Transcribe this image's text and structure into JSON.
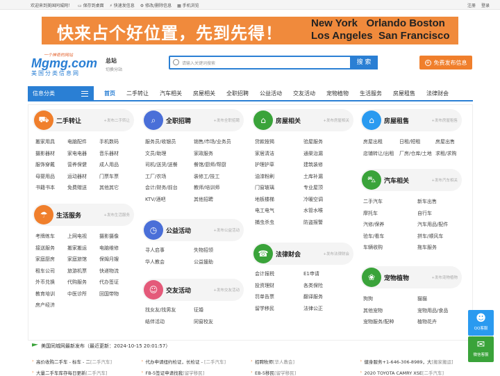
{
  "topbar": {
    "welcome": "欢迎来到美国同城网！",
    "save_desktop": "保存到桌面",
    "quick_post": "快速发信息",
    "edit_delete": "修改/删除信息",
    "mobile": "手机浏览",
    "register": "注册",
    "login": "登录"
  },
  "banner": {
    "slogan": "快来占个好位置，先到先得！",
    "city1a": "New York",
    "city1b": "Orlando",
    "city1c": "Boston",
    "city2a": "Los Angeles",
    "city2b": "San Francisco"
  },
  "logo": {
    "slogan": "一个神奇的网站",
    "main": "Mgmg.com",
    "sub": "美国分类信息网"
  },
  "region": {
    "name": "总站",
    "switch": "切换分站"
  },
  "search": {
    "placeholder": "请输入关键词搜索",
    "button": "搜 索"
  },
  "post_button": "免费发布信息",
  "nav": {
    "category": "信息分类",
    "items": [
      "首页",
      "二手转让",
      "汽车相关",
      "房屋相关",
      "全职招聘",
      "公益活动",
      "交友活动",
      "宠物植物",
      "生活服务",
      "房屋租售",
      "法律财会"
    ]
  },
  "colors": {
    "brand": "#2a7fd4",
    "accent": "#f07f2c",
    "green": "#3aa33a"
  },
  "blocks": {
    "secondhand": {
      "title": "二手转让",
      "more": "+发布二手转让",
      "links": [
        "搬家用具",
        "电脑配件",
        "手机数码",
        "摄影器材",
        "家电电器",
        "音乐器材",
        "服饰穿戴",
        "营养保健",
        "成人用品",
        "母婴用品",
        "运动器材",
        "门票车票",
        "书籍书本",
        "免费赠送",
        "其他其它"
      ]
    },
    "life": {
      "title": "生活服务",
      "more": "+发布生活服务",
      "links": [
        "考牌练车",
        "上网电视",
        "摄影摄像",
        "接送服务",
        "搬家搬运",
        "电脑维修",
        "家庭厨房",
        "家庭旅馆",
        "保姆月嫂",
        "租车公司",
        "旅游机票",
        "快递物流",
        "外币兑换",
        "代购服务",
        "代办签证",
        "教育培训",
        "中医诊所",
        "回国带物",
        "房产经济"
      ]
    },
    "jobs": {
      "title": "全职招聘",
      "more": "+发布全职招聘",
      "links": [
        "服务员/收银员",
        "销售/市场/业务员",
        "文员/助理",
        "家政服务",
        "司机/送货/送餐",
        "餐馆/厨师/帮厨",
        "工厂/农场",
        "装修工/技工",
        "会计/财务/前台",
        "教师/培训师",
        "KTV/酒吧",
        "其他招聘"
      ]
    },
    "charity": {
      "title": "公益活动",
      "more": "+发布公益活动",
      "links": [
        "寻人启事",
        "失物招领",
        "华人教会",
        "公益援助"
      ]
    },
    "dating": {
      "title": "交友活动",
      "more": "+发布交友活动",
      "links": [
        "找女友/找男友",
        "征婚",
        "结伴活动",
        "同窗校友"
      ]
    },
    "housing": {
      "title": "房屋相关",
      "more": "+发布房屋相关",
      "links": [
        "贷款按揭",
        "验屋服务",
        "家居清洁",
        "通渠治漏",
        "护理护草",
        "建筑装修",
        "油漆粉刷",
        "土库补漏",
        "门窗玻璃",
        "专业屋顶",
        "地板楼梯",
        "冷暖空调",
        "电工电气",
        "水管水喉",
        "捕虫杀虫",
        "防盗报警"
      ]
    },
    "legal": {
      "title": "法律财会",
      "more": "+发布法律财会",
      "links": [
        "会计报税",
        "E1申请",
        "投资理财",
        "各类保险",
        "罚单告票",
        "翻译服务",
        "留学移民",
        "法律公正"
      ]
    },
    "rental": {
      "title": "房屋租售",
      "more": "+发布房屋租售",
      "links": [
        "房屋出租",
        "日租/短租",
        "房屋出售",
        "店铺转让/出租",
        "厂房/仓库/土地",
        "求租/求购"
      ]
    },
    "car": {
      "title": "汽车相关",
      "more": "+发布汽车相关",
      "links": [
        "二手汽车",
        "新车出售",
        "摩托车",
        "自行车",
        "汽修/保养",
        "汽车用品/配件",
        "验车/看车",
        "拼车/顺风车",
        "车辆收购",
        "拖车服务"
      ]
    },
    "pet": {
      "title": "宠物植物",
      "more": "+发布宠物植物",
      "links": [
        "狗狗",
        "猫猫",
        "其他宠物",
        "宠物用品/食品",
        "宠物服务/配种",
        "植物花卉"
      ]
    }
  },
  "latest": {
    "title": "美国同城网最新发布（最近更新：2024-10-15 20:01:57）",
    "row1": [
      {
        "text": "高价收购二手车 - 标车 - 二",
        "tag": "[二手汽车]"
      },
      {
        "text": "代办申请纽约检证，长检证 - ",
        "tag": "[二手汽车]"
      },
      {
        "text": "招聘牧师",
        "tag": "[华人教会]"
      },
      {
        "text": "健身服务+1-646-306-8989，大",
        "tag": "[搬家搬运]"
      }
    ],
    "row2": [
      {
        "text": "大量二手车库存每日更新",
        "tag": "[二手汽车]"
      },
      {
        "text": "FB-5签证申请找我",
        "tag": "[留学移民]"
      },
      {
        "text": "EB-5移民",
        "tag": "[留学移民]"
      },
      {
        "text": "2020 TOYOTA CAMRY XSE",
        "tag": "[二手汽车]"
      }
    ]
  },
  "side": {
    "qq": "QQ客服",
    "wechat": "微信客服"
  }
}
